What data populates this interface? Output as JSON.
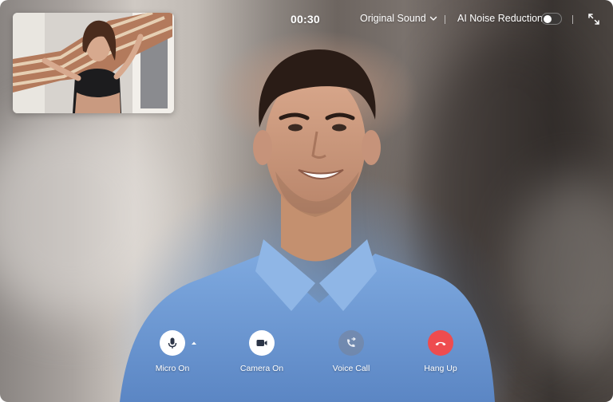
{
  "call": {
    "timer": "00:30",
    "sound_mode": "Original Sound",
    "noise_reduction_label": "AI Noise Reduction",
    "noise_reduction_enabled": false
  },
  "controls": [
    {
      "label": "Micro On",
      "icon": "microphone-icon",
      "style": "white"
    },
    {
      "label": "Camera On",
      "icon": "video-camera-icon",
      "style": "white"
    },
    {
      "label": "Voice Call",
      "icon": "voice-call-icon",
      "style": "grey"
    },
    {
      "label": "Hang Up",
      "icon": "hang-up-phone-icon",
      "style": "red"
    }
  ],
  "colors": {
    "hang_up": "#ee4c4f",
    "control_white": "#ffffff",
    "control_grey": "#78829a",
    "shirt_blue": "#6f9dd6"
  }
}
